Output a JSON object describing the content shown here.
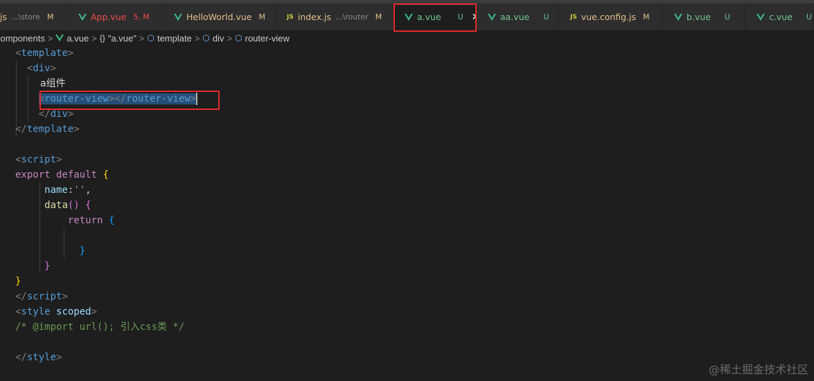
{
  "colors": {
    "vue_icon": "#41b883",
    "modified": "#e2c08d",
    "untracked": "#73c991",
    "error_name": "#f14c4c",
    "highlight_box": "#e62b2b",
    "selection": "#264f78"
  },
  "tabs": [
    {
      "icon": "js-icon",
      "icon_text": "JS",
      "name": "js",
      "path": "...\\store",
      "status": "M"
    },
    {
      "icon": "vue-icon",
      "name": "App.vue",
      "status": "5, M"
    },
    {
      "icon": "vue-icon",
      "name": "HelloWorld.vue",
      "status": "M"
    },
    {
      "icon": "js-icon",
      "icon_text": "JS",
      "name": "index.js",
      "path": "...\\router",
      "status": "M"
    },
    {
      "icon": "vue-icon",
      "name": "a.vue",
      "status": "U",
      "active": true,
      "close": "✕"
    },
    {
      "icon": "vue-icon",
      "name": "aa.vue",
      "status": "U"
    },
    {
      "icon": "js-icon",
      "icon_text": "JS",
      "name": "vue.config.js",
      "status": "M"
    },
    {
      "icon": "vue-icon",
      "name": "b.vue",
      "status": "U"
    },
    {
      "icon": "vue-icon",
      "name": "c.vue",
      "status": "U"
    }
  ],
  "breadcrumb": {
    "seg1": "components",
    "seg2": "a.vue",
    "seg3_icon": "{}",
    "seg3": "\"a.vue\"",
    "seg4": "template",
    "seg5": "div",
    "seg6": "router-view"
  },
  "code": {
    "l1_tag": "template",
    "l2_tag": "div",
    "l3_text": "a组件",
    "l4_tag": "router-view",
    "l5_tag": "div",
    "l6_tag": "template",
    "l8_tag": "script",
    "l9_kw1": "export",
    "l9_kw2": "default",
    "l9_brace": "{",
    "l10_prop": "name",
    "l10_str": "''",
    "l11_fn": "data",
    "l12_kw": "return",
    "l12_brace": "{",
    "l14_brace": "}",
    "l15_brace": "}",
    "l16_brace": "}",
    "l17_tag": "script",
    "l18_tag": "style",
    "l18_attr": "scoped",
    "l19_comment": "/* @import url(); 引入css类 */",
    "l21_tag": "style"
  },
  "watermark": "@稀土掘金技术社区"
}
